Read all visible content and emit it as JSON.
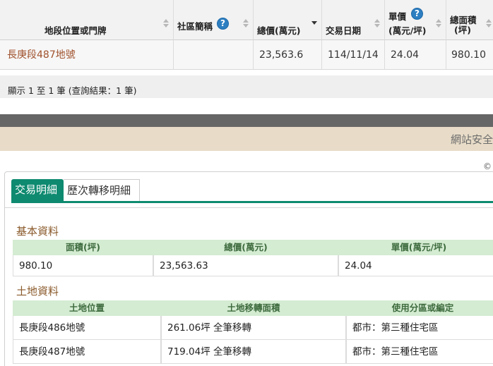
{
  "results": {
    "headers": {
      "location": "地段位置或門牌",
      "community": "社區簡稱",
      "total_price": "總價(萬元)",
      "trade_date": "交易日期",
      "unit_price_l1": "單價",
      "unit_price_l2": "(萬元/坪)",
      "area_l1": "總面積",
      "area_l2": "(坪)"
    },
    "help_glyph": "?",
    "row": {
      "location": "長庚段487地號",
      "community": "",
      "total_price": "23,563.6",
      "trade_date": "114/11/14",
      "unit_price": "24.04",
      "area": "980.10"
    },
    "pager_text": "顯示 1 至 1 筆 (查詢結果：1 筆)",
    "sort_column": "total_price"
  },
  "banner": {
    "notice": "網站安全",
    "copyright_glyph": "©"
  },
  "detail": {
    "tabs": [
      {
        "label": "交易明細",
        "active": true
      },
      {
        "label": "歷次轉移明細",
        "active": false
      }
    ],
    "basic": {
      "title": "基本資料",
      "headers": [
        "面積(坪)",
        "總價(萬元)",
        "單價(萬元/坪)"
      ],
      "values": [
        "980.10",
        "23,563.63",
        "24.04"
      ]
    },
    "land": {
      "title": "土地資料",
      "headers": [
        "土地位置",
        "土地移轉面積",
        "使用分區或編定"
      ],
      "rows": [
        [
          "長庚段486地號",
          "261.06坪 全筆移轉",
          "都市：第三種住宅區"
        ],
        [
          "長庚段487地號",
          "719.04坪 全筆移轉",
          "都市：第三種住宅區"
        ]
      ]
    }
  },
  "colors": {
    "accent_green": "#0e8a70",
    "section_title": "#8a5a2b",
    "link_brown": "#a0522d",
    "header_green_bg": "#d4ecd2",
    "help_blue": "#2d7fc1"
  }
}
